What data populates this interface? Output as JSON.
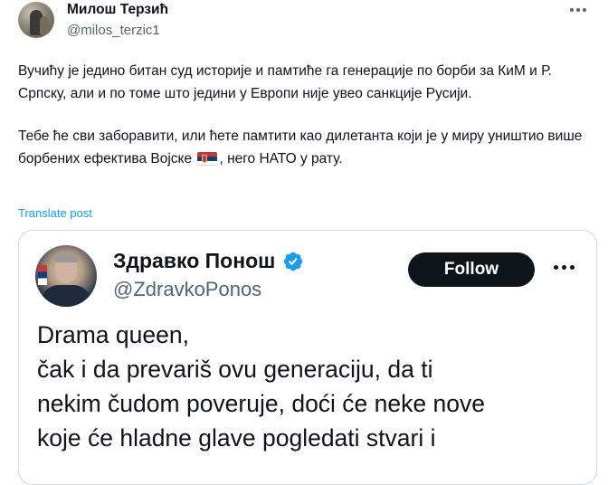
{
  "tweet": {
    "author_name": "Милош Терзић",
    "author_handle": "@milos_terzic1",
    "paragraph1": "Вучићу је једино битан суд историје и памтиће га генерације по борби за КиМ и Р. Српску, али и по томе што једини у Европи није увео санкције Русији.",
    "paragraph2_before_flag": "Тебе ће сви заборавити, или ћете памтити као дилетанта који је у миру уништио више борбених ефектива Војске",
    "paragraph2_after_flag": ", него НАТО у рату.",
    "translate_label": "Translate post",
    "flag_icon": "serbia-flag-emoji"
  },
  "quoted": {
    "author_name": "Здравко Понош",
    "author_handle": "@ZdravkoPonos",
    "follow_label": "Follow",
    "verified_color": "#1d9bf0",
    "lines": [
      "Drama queen,",
      "čak i da prevariš ovu generaciju, da ti",
      "nekim čudom poveruje, doći će neke nove",
      "koje će hladne glave pogledati stvari i"
    ]
  },
  "colors": {
    "link": "#1d9bf0",
    "text": "#0f1419",
    "secondary": "#536471",
    "border": "#cfd9de"
  }
}
